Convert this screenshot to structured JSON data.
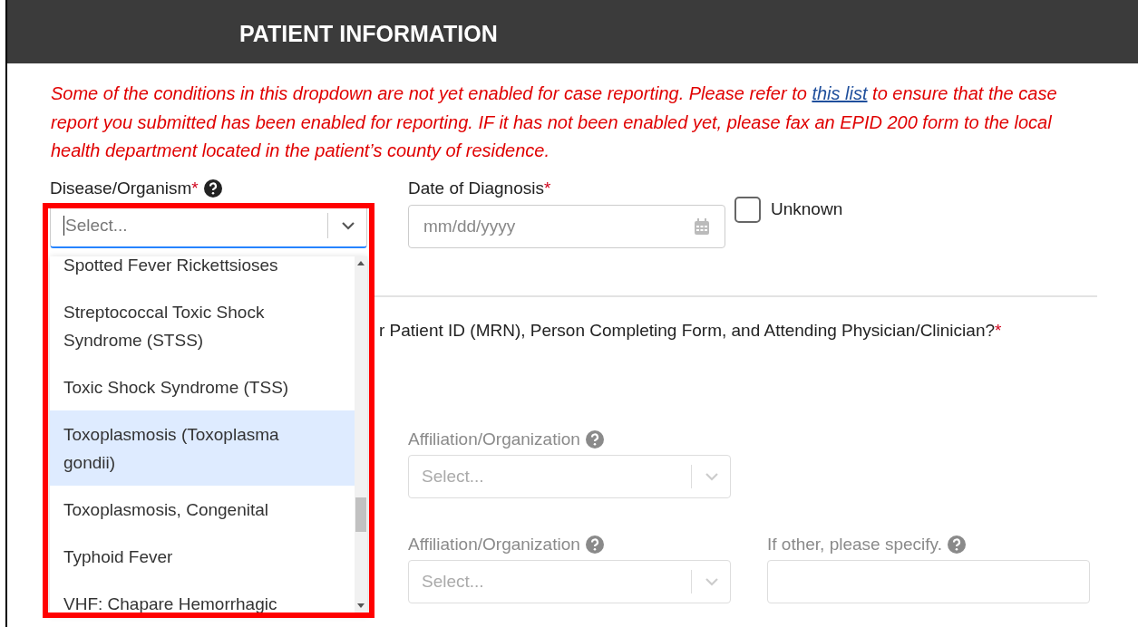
{
  "header": {
    "title": "PATIENT INFORMATION"
  },
  "notice": {
    "text_before": "Some of the conditions in this dropdown are not yet enabled for case reporting. Please refer to",
    "link": "this list",
    "text_after": "to ensure that the case report you submitted has been enabled for reporting. IF it has not been enabled yet, please fax an EPID 200 form to the local health department located in the patient’s county of residence."
  },
  "disease_field": {
    "label": "Disease/Organism",
    "required_mark": "*",
    "placeholder": "Select...",
    "focused": true
  },
  "date_field": {
    "label": "Date of Diagnosis",
    "required_mark": "*",
    "placeholder": "mm/dd/yyyy"
  },
  "unknown_checkbox": {
    "label": "Unknown",
    "checked": false
  },
  "question": {
    "text": "r Patient ID (MRN), Person Completing Form, and Attending Physician/Clinician?",
    "required_mark": "*"
  },
  "affiliation_rows": [
    {
      "fields": [
        {
          "kind": "select",
          "label": "Affiliation/Organization",
          "placeholder": "Select...",
          "disabled": true
        }
      ]
    },
    {
      "fields": [
        {
          "kind": "select",
          "label": "Affiliation/Organization",
          "placeholder": "Select...",
          "disabled": true
        },
        {
          "kind": "text",
          "label": "If other, please specify.",
          "disabled": true
        }
      ]
    }
  ],
  "dropdown": {
    "items": [
      {
        "label": "Spotted Fever Rickettsioses",
        "highlighted": false
      },
      {
        "label": "Streptococcal Toxic Shock Syndrome (STSS)",
        "highlighted": false
      },
      {
        "label": "Toxic Shock Syndrome (TSS)",
        "highlighted": false
      },
      {
        "label": "Toxoplasmosis (Toxoplasma gondii)",
        "highlighted": true
      },
      {
        "label": "Toxoplasmosis, Congenital",
        "highlighted": false
      },
      {
        "label": "Typhoid Fever",
        "highlighted": false
      },
      {
        "label": "VHF: Chapare Hemorrhagic",
        "highlighted": false
      }
    ]
  }
}
